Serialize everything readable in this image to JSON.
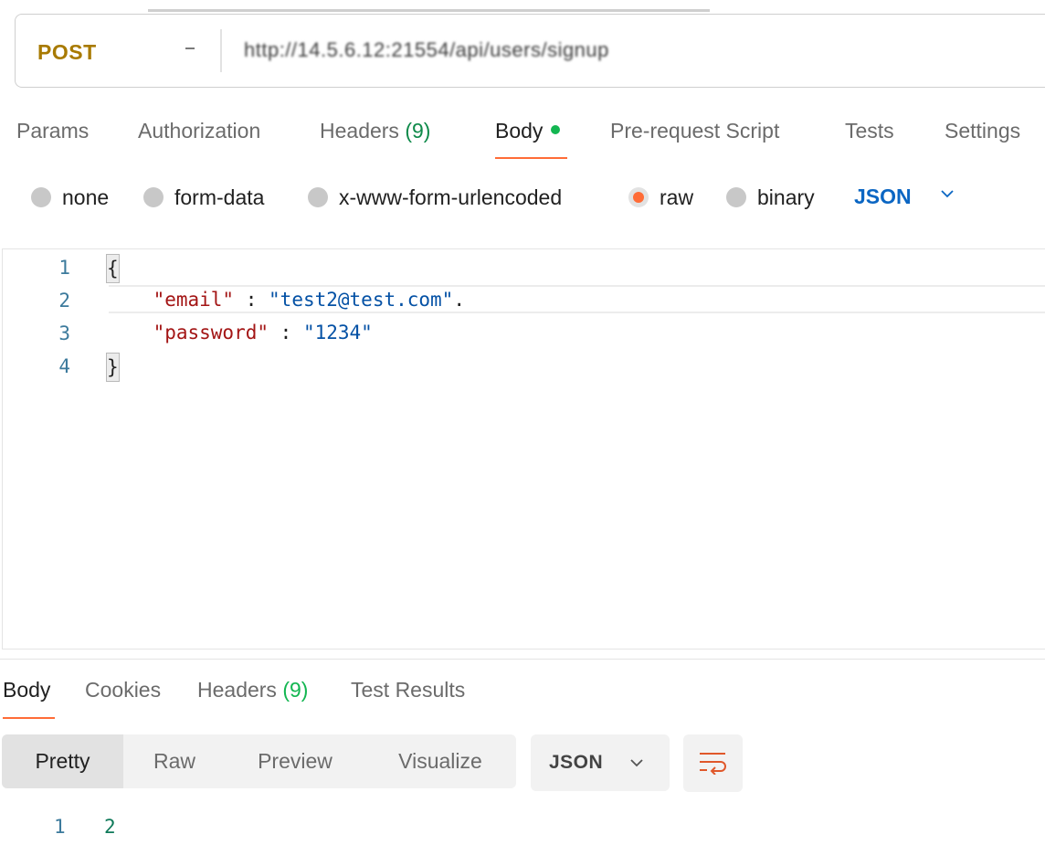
{
  "request": {
    "method": "POST",
    "url": "http://14.5.6.12:21554/api/users/signup"
  },
  "request_tabs": {
    "params": "Params",
    "authorization": "Authorization",
    "headers": "Headers",
    "headers_count": "(9)",
    "body": "Body",
    "prerequest": "Pre-request Script",
    "tests": "Tests",
    "settings": "Settings"
  },
  "body_types": {
    "none": "none",
    "form_data": "form-data",
    "urlencoded": "x-www-form-urlencoded",
    "raw": "raw",
    "binary": "binary",
    "selected": "raw",
    "format": "JSON"
  },
  "editor": {
    "line_numbers": [
      "1",
      "2",
      "3",
      "4"
    ],
    "open_brace": "{",
    "close_brace": "}",
    "line2_key": "\"email\"",
    "line2_sep": " : ",
    "line2_value": "\"test2@test.com\"",
    "line2_trail": ".",
    "line3_key": "\"password\"",
    "line3_sep": " : ",
    "line3_value": "\"1234\""
  },
  "response_tabs": {
    "body": "Body",
    "cookies": "Cookies",
    "headers": "Headers",
    "headers_count": "(9)",
    "test_results": "Test Results"
  },
  "response_view": {
    "pretty": "Pretty",
    "raw": "Raw",
    "preview": "Preview",
    "visualize": "Visualize",
    "format": "JSON",
    "wrap_icon": "wrap-lines-icon",
    "line_numbers": [
      "1",
      "2"
    ]
  },
  "colors": {
    "method": "#a87a00",
    "accent": "#ff6c37",
    "link": "#0b66c3",
    "count": "#0f8a4a"
  }
}
